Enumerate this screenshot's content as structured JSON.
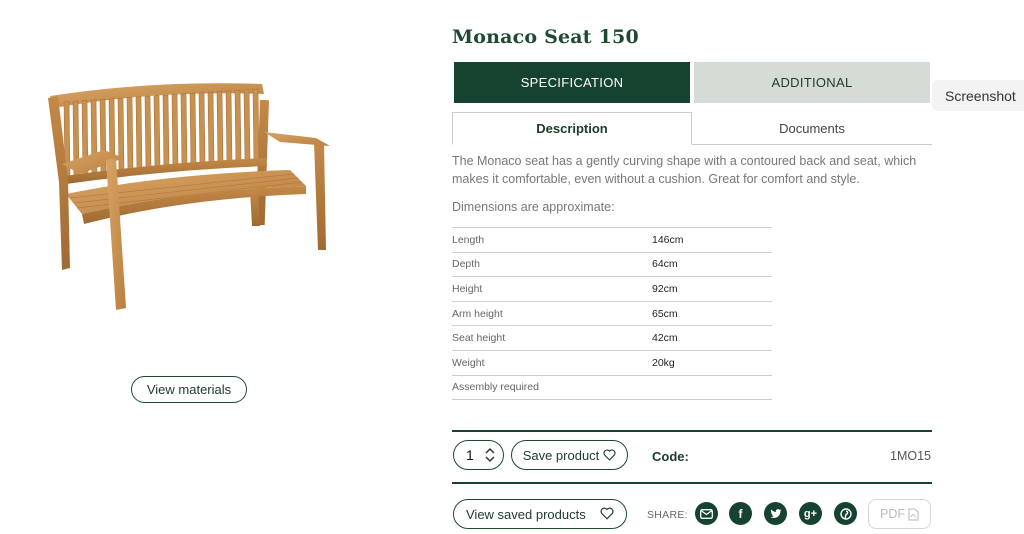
{
  "product": {
    "title": "Monaco Seat 150",
    "view_materials_label": "View materials"
  },
  "tabs": {
    "main": [
      {
        "label": "SPECIFICATION",
        "active": true
      },
      {
        "label": "ADDITIONAL",
        "active": false
      }
    ],
    "sub": [
      {
        "label": "Description",
        "active": true
      },
      {
        "label": "Documents",
        "active": false
      }
    ]
  },
  "overlay": {
    "screenshot_label": "Screenshot"
  },
  "description": {
    "text": "The Monaco seat has a gently curving shape with a contoured back and seat, which makes it comfortable, even without a cushion. Great for comfort and style.",
    "dimensions_label": "Dimensions are approximate:"
  },
  "specs": [
    {
      "label": "Length",
      "value": "146cm"
    },
    {
      "label": "Depth",
      "value": "64cm"
    },
    {
      "label": "Height",
      "value": "92cm"
    },
    {
      "label": "Arm height",
      "value": "65cm"
    },
    {
      "label": "Seat height",
      "value": "42cm"
    },
    {
      "label": "Weight",
      "value": "20kg"
    },
    {
      "label": "Assembly required",
      "value": ""
    }
  ],
  "purchase": {
    "quantity": "1",
    "save_label": "Save product",
    "code_label": "Code:",
    "code_value": "1MO15"
  },
  "footer": {
    "saved_label": "View saved products",
    "share_label": "SHARE:",
    "social_icons": [
      "email-icon",
      "facebook-icon",
      "twitter-icon",
      "google-plus-icon",
      "pinterest-icon"
    ],
    "pdf_label": "PDF"
  },
  "colors": {
    "brand_green": "#164230",
    "tab_inactive": "#d5dcd6",
    "wood": "#c8904f"
  }
}
